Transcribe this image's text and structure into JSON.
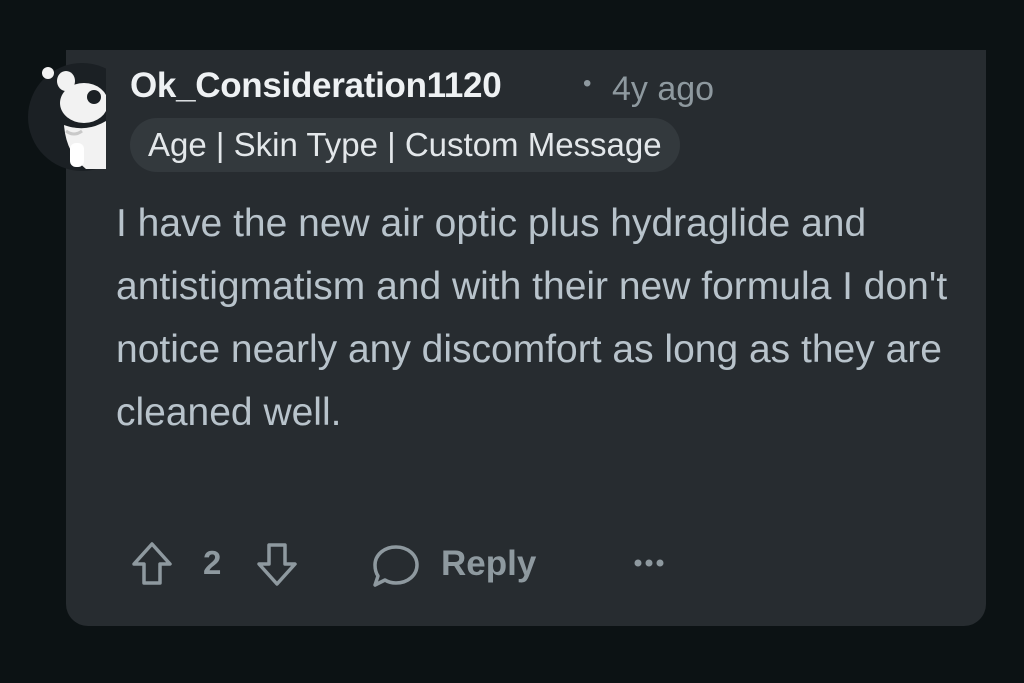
{
  "comment": {
    "username": "Ok_Consideration1120",
    "separator": "•",
    "age": "4y ago",
    "flair": "Age | Skin Type | Custom Message",
    "body": "I have the new air optic plus hydraglide and antistigmatism and with their new formula I don't notice nearly any discomfort as long as they are cleaned well."
  },
  "actions": {
    "upvote_icon": "arrow-up-icon",
    "vote_count": "2",
    "downvote_icon": "arrow-down-icon",
    "reply_icon": "speech-bubble-icon",
    "reply_label": "Reply",
    "more_icon": "ellipsis-icon"
  },
  "colors": {
    "page_background": "#0c1214",
    "card_background": "#272c30",
    "username": "#eef1f3",
    "body_text": "#b8c3cb",
    "muted": "#8e999f",
    "flair_background": "#33393d"
  }
}
